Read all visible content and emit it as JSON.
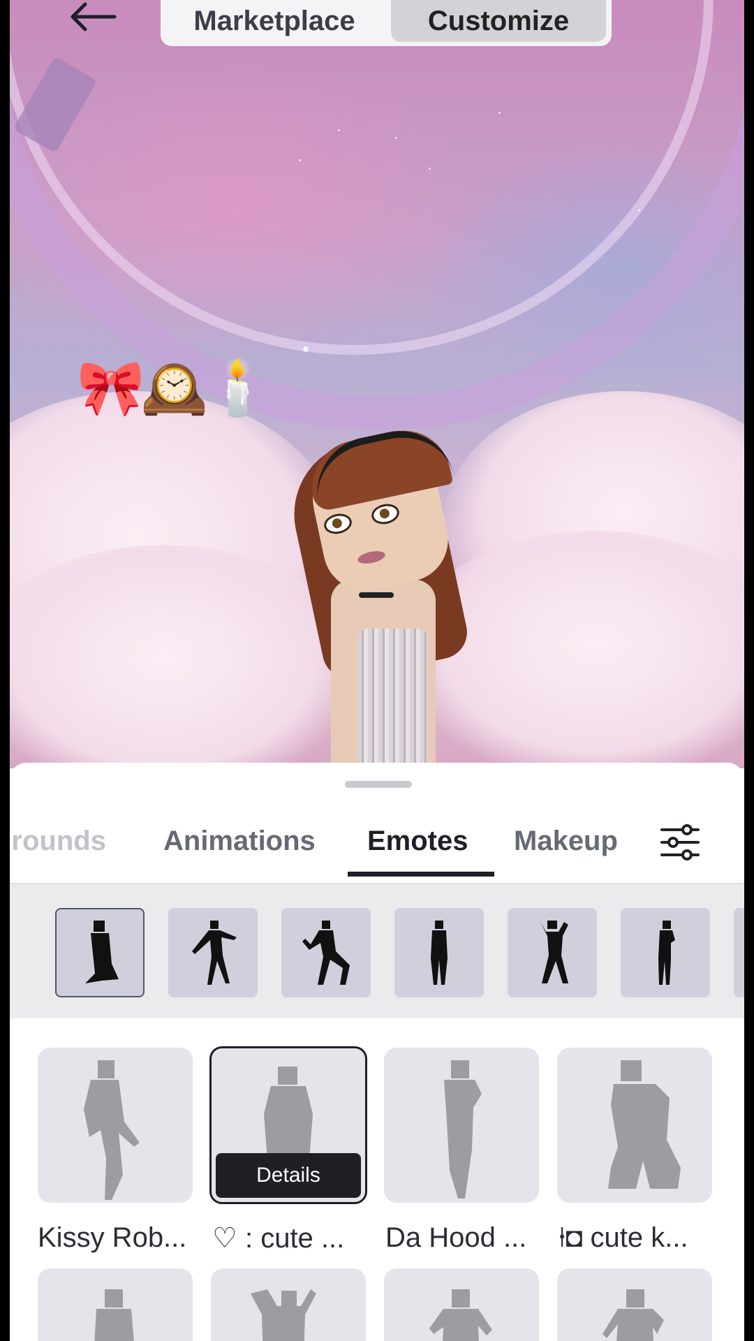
{
  "header": {
    "segments": [
      "Marketplace",
      "Customize"
    ],
    "active_segment": "Customize"
  },
  "scene": {
    "emoji_tags": "🎀🕰️🕯️"
  },
  "tabs": {
    "items": [
      "grounds",
      "Animations",
      "Emotes",
      "Makeup"
    ],
    "active": "Emotes"
  },
  "emote_items": [
    {
      "label": "Kissy Rob..."
    },
    {
      "label": "♡ : cute ..."
    },
    {
      "label": "Da Hood ..."
    },
    {
      "label": "⍿◘ cute k..."
    }
  ],
  "details_label": "Details",
  "icons": [
    "back-arrow-icon",
    "filter-sliders-icon"
  ]
}
